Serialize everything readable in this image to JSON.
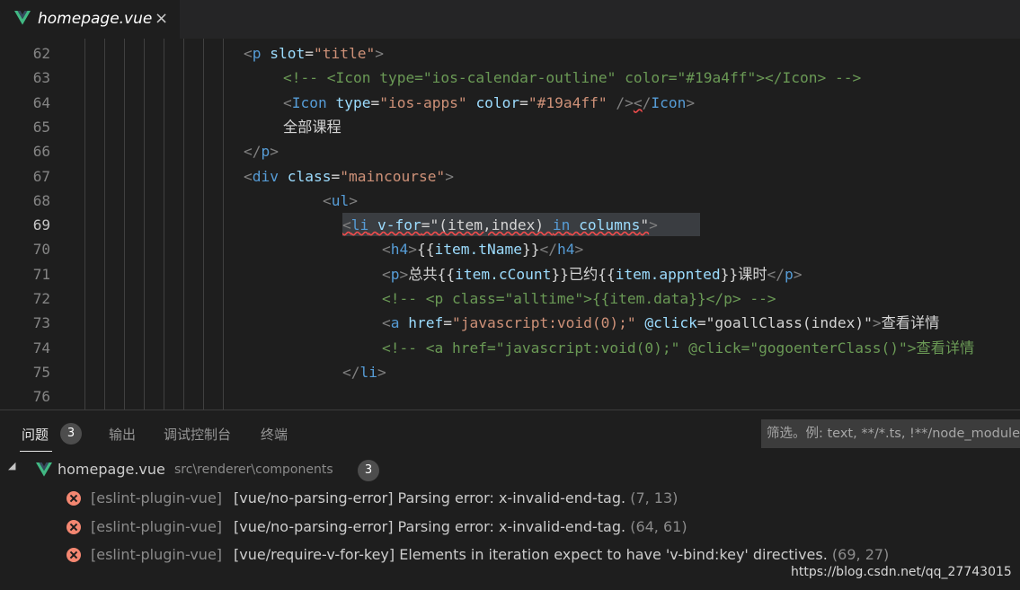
{
  "tab": {
    "title": "homepage.vue",
    "close": "×",
    "logo_color": "#41b883"
  },
  "editor": {
    "active_line": "69",
    "lines": [
      {
        "n": "62",
        "tokens": [
          [
            "br",
            "<"
          ],
          [
            "tag",
            "p"
          ],
          [
            "txt",
            " "
          ],
          [
            "attr",
            "slot"
          ],
          [
            "txt",
            "="
          ],
          [
            "str",
            "\"title\""
          ],
          [
            "br",
            ">"
          ]
        ]
      },
      {
        "n": "63",
        "tokens": [
          [
            "cmt",
            "<!-- <Icon type=\"ios-calendar-outline\" color=\"#19a4ff\"></Icon> -->"
          ]
        ]
      },
      {
        "n": "64",
        "tokens": [
          [
            "br",
            "<"
          ],
          [
            "tag",
            "Icon"
          ],
          [
            "txt",
            " "
          ],
          [
            "attr",
            "type"
          ],
          [
            "txt",
            "="
          ],
          [
            "str",
            "\"ios-apps\""
          ],
          [
            "txt",
            " "
          ],
          [
            "attr",
            "color"
          ],
          [
            "txt",
            "="
          ],
          [
            "str",
            "\"#19a4ff\""
          ],
          [
            "txt",
            " "
          ],
          [
            "br",
            "/>"
          ],
          [
            "brsq",
            "<"
          ],
          [
            "br",
            "/"
          ],
          [
            "tag",
            "Icon"
          ],
          [
            "br",
            ">"
          ]
        ]
      },
      {
        "n": "65",
        "tokens": [
          [
            "txt",
            "全部课程"
          ]
        ]
      },
      {
        "n": "66",
        "tokens": [
          [
            "br",
            "</"
          ],
          [
            "tag",
            "p"
          ],
          [
            "br",
            ">"
          ]
        ]
      },
      {
        "n": "67",
        "tokens": [
          [
            "br",
            "<"
          ],
          [
            "tag",
            "div"
          ],
          [
            "txt",
            " "
          ],
          [
            "attr",
            "class"
          ],
          [
            "txt",
            "="
          ],
          [
            "str",
            "\"maincourse\""
          ],
          [
            "br",
            ">"
          ]
        ]
      },
      {
        "n": "68",
        "tokens": [
          [
            "br",
            "<"
          ],
          [
            "tag",
            "ul"
          ],
          [
            "br",
            ">"
          ]
        ]
      },
      {
        "n": "69",
        "tokens": [
          [
            "brsq",
            "<"
          ],
          [
            "tagsq",
            "li"
          ],
          [
            "txtsq",
            " "
          ],
          [
            "attrsq",
            "v-for"
          ],
          [
            "txtsq",
            "=\"(item,index) "
          ],
          [
            "tagsq",
            "in"
          ],
          [
            "attrsq",
            " columns"
          ],
          [
            "txtsq",
            "\""
          ],
          [
            "br",
            ">"
          ]
        ]
      },
      {
        "n": "70",
        "tokens": [
          [
            "br",
            "<"
          ],
          [
            "tag",
            "h4"
          ],
          [
            "br",
            ">"
          ],
          [
            "txt",
            "{{"
          ],
          [
            "attr",
            "item.tName"
          ],
          [
            "txt",
            "}}"
          ],
          [
            "br",
            "</"
          ],
          [
            "tag",
            "h4"
          ],
          [
            "br",
            ">"
          ]
        ]
      },
      {
        "n": "71",
        "tokens": [
          [
            "br",
            "<"
          ],
          [
            "tag",
            "p"
          ],
          [
            "br",
            ">"
          ],
          [
            "txt",
            "总共{{"
          ],
          [
            "attr",
            "item.cCount"
          ],
          [
            "txt",
            "}}已约{{"
          ],
          [
            "attr",
            "item.appnted"
          ],
          [
            "txt",
            "}}课时"
          ],
          [
            "br",
            "</"
          ],
          [
            "tag",
            "p"
          ],
          [
            "br",
            ">"
          ]
        ]
      },
      {
        "n": "72",
        "tokens": [
          [
            "cmt",
            "<!-- <p class=\"alltime\">{{item.data}}</p> -->"
          ]
        ]
      },
      {
        "n": "73",
        "tokens": [
          [
            "br",
            "<"
          ],
          [
            "tag",
            "a"
          ],
          [
            "txt",
            " "
          ],
          [
            "attr",
            "href"
          ],
          [
            "txt",
            "="
          ],
          [
            "str",
            "\"javascript:void(0);\""
          ],
          [
            "txt",
            " "
          ],
          [
            "attr",
            "@click"
          ],
          [
            "txt",
            "=\""
          ],
          [
            "txt",
            "goallClass(index)"
          ],
          [
            "txt",
            "\""
          ],
          [
            "br",
            ">"
          ],
          [
            "txt",
            "查看详情"
          ]
        ]
      },
      {
        "n": "74",
        "tokens": [
          [
            "cmt",
            "<!-- <a href=\"javascript:void(0);\" @click=\"gogoenterClass()\">查看详情"
          ]
        ]
      },
      {
        "n": "75",
        "tokens": [
          [
            "br",
            "</"
          ],
          [
            "tag",
            "li"
          ],
          [
            "br",
            ">"
          ]
        ]
      },
      {
        "n": "76",
        "tokens": []
      }
    ]
  },
  "panel": {
    "tabs": [
      "问题",
      "输出",
      "调试控制台",
      "终端"
    ],
    "problems_count": "3",
    "filter_placeholder": "筛选。例: text, **/*.ts, !**/node_modules/**",
    "file": {
      "name": "homepage.vue",
      "path": "src\\renderer\\components",
      "count": "3"
    },
    "errors": [
      {
        "source": "[eslint-plugin-vue]",
        "message": "[vue/no-parsing-error] Parsing error: x-invalid-end-tag.",
        "pos": "(7, 13)"
      },
      {
        "source": "[eslint-plugin-vue]",
        "message": "[vue/no-parsing-error] Parsing error: x-invalid-end-tag.",
        "pos": "(64, 61)"
      },
      {
        "source": "[eslint-plugin-vue]",
        "message": "[vue/require-v-for-key] Elements in iteration expect to have 'v-bind:key' directives.",
        "pos": "(69, 27)"
      }
    ]
  },
  "watermark": "https://blog.csdn.net/qq_27743015"
}
